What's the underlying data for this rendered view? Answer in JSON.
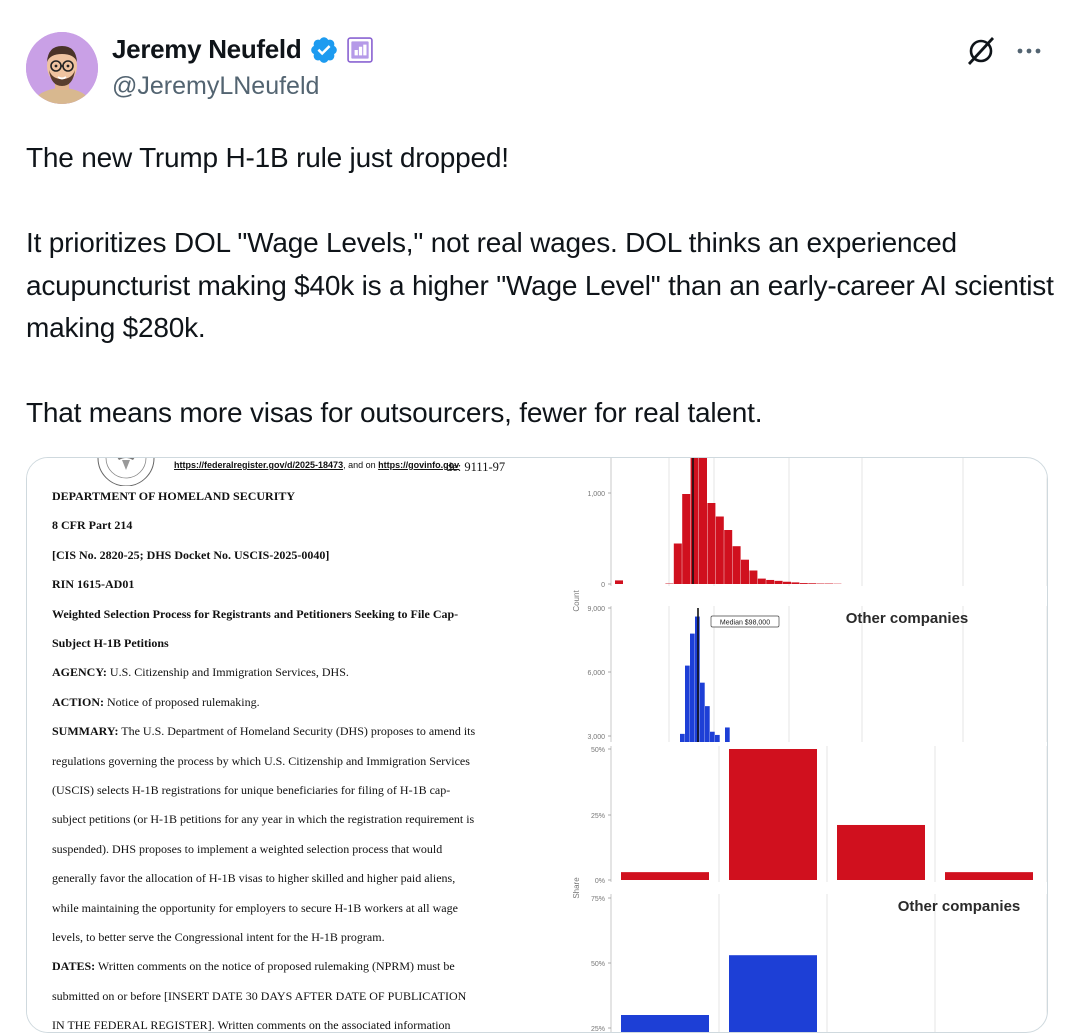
{
  "author": {
    "display_name": "Jeremy Neufeld",
    "handle": "@JeremyLNeufeld"
  },
  "icons": {
    "verified": "verified-badge-icon",
    "affiliation": "affiliation-badge-icon",
    "grok": "grok-icon",
    "more": "more-options-icon"
  },
  "tweet": {
    "paragraphs": [
      "The new Trump H-1B rule just dropped!",
      "It prioritizes DOL \"Wage Levels,\" not real wages. DOL thinks an experienced acupuncturist making $40k is a higher \"Wage Level\" than an early-career AI scientist making $280k.",
      "That means more visas for outsourcers, fewer for real talent."
    ]
  },
  "document": {
    "top_link_text": "https://federalregister.gov/d/2025-18473",
    "top_link_mid": ", and on ",
    "top_link_text2": "https://govinfo.gov",
    "top_code": "de:  9111-97",
    "lines": [
      {
        "b": "DEPARTMENT OF HOMELAND SECURITY",
        "t": ""
      },
      {
        "b": "8 CFR Part 214",
        "t": ""
      },
      {
        "b": "[CIS No. 2820-25; DHS Docket No. USCIS-2025-0040]",
        "t": ""
      },
      {
        "b": "RIN 1615-AD01",
        "t": ""
      },
      {
        "b": "Weighted Selection Process for Registrants and Petitioners Seeking to File Cap-",
        "t": ""
      },
      {
        "b": "Subject H-1B Petitions",
        "t": ""
      },
      {
        "b": "AGENCY:",
        "t": " U.S. Citizenship and Immigration Services, DHS."
      },
      {
        "b": "ACTION:",
        "t": " Notice of proposed rulemaking."
      },
      {
        "b": "SUMMARY:",
        "t": " The U.S. Department of Homeland Security (DHS) proposes to amend its"
      },
      {
        "b": "",
        "t": "regulations governing the process by which U.S. Citizenship and Immigration Services"
      },
      {
        "b": "",
        "t": "(USCIS) selects H-1B registrations for unique beneficiaries for filing of H-1B cap-"
      },
      {
        "b": "",
        "t": "subject petitions (or H-1B petitions for any year in which the registration requirement is"
      },
      {
        "b": "",
        "t": "suspended). DHS proposes to implement a weighted selection process that would"
      },
      {
        "b": "",
        "t": "generally favor the allocation of H-1B visas to higher skilled and higher paid aliens,"
      },
      {
        "b": "",
        "t": "while maintaining the opportunity for employers to secure H-1B workers at all wage"
      },
      {
        "b": "",
        "t": "levels, to better serve the Congressional intent for the H-1B program."
      },
      {
        "b": "DATES:",
        "t": " Written comments on the notice of proposed rulemaking (NPRM) must be"
      },
      {
        "b": "",
        "t": "submitted on or before [INSERT DATE 30 DAYS AFTER DATE OF PUBLICATION"
      },
      {
        "b": "",
        "t": "IN THE FEDERAL REGISTER]. Written comments on the associated information"
      }
    ]
  },
  "chart_data": [
    {
      "type": "bar",
      "panel": "histogram-top",
      "ylabel": "Count",
      "yticks": [
        "1,000",
        "0"
      ],
      "ylim": [
        0,
        1400
      ],
      "color": "#d0101e",
      "values": [
        40,
        0,
        0,
        0,
        0,
        0,
        5,
        450,
        1000,
        1400,
        1400,
        900,
        750,
        600,
        420,
        270,
        150,
        60,
        45,
        35,
        25,
        18,
        10,
        8,
        5,
        5,
        3
      ]
    },
    {
      "type": "bar",
      "panel": "histogram-bottom",
      "ylabel": "Count",
      "yticks": [
        "9,000",
        "6,000",
        "3,000"
      ],
      "ylim": [
        3000,
        9000
      ],
      "color": "#1d3fd6",
      "annotation": "Median $98,000",
      "series_label": "Other companies",
      "values": [
        0,
        0,
        0,
        0,
        0,
        0,
        0,
        0,
        0,
        3100,
        6300,
        7800,
        8600,
        5500,
        4400,
        3200,
        3050,
        0,
        3400
      ]
    },
    {
      "type": "bar",
      "panel": "share-top",
      "ylabel": "Share",
      "yticks": [
        "50%",
        "25%",
        "0%"
      ],
      "ylim": [
        0,
        50
      ],
      "color": "#d0101e",
      "values": [
        3,
        50,
        21,
        3
      ]
    },
    {
      "type": "bar",
      "panel": "share-bottom",
      "ylabel": "Share",
      "yticks": [
        "75%",
        "50%",
        "25%"
      ],
      "ylim": [
        25,
        75
      ],
      "color": "#1d3fd6",
      "series_label": "Other companies",
      "values": [
        30,
        53,
        0,
        0
      ]
    }
  ]
}
